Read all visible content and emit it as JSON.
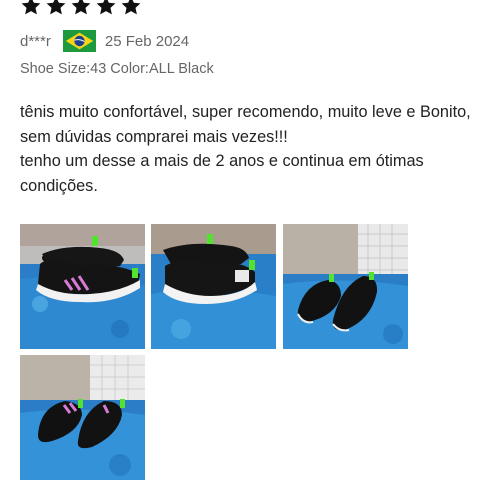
{
  "rating": {
    "value": 5,
    "max": 5,
    "icon": "star-icon",
    "color": "#111111"
  },
  "review": {
    "reviewer": "d***r",
    "country_flag_icon": "brazil-flag-icon",
    "date": "25 Feb 2024",
    "sku": "Shoe Size:43 Color:ALL Black",
    "text_lines": [
      "tênis muito confortável, super recomendo, muito leve e Bonito, sem dúvidas comprarei mais vezes!!!",
      "tenho um desse a mais de 2 anos e continua em ótimas condições."
    ]
  },
  "photos": [
    {
      "name": "review-photo-1",
      "icon": "shoe-photo"
    },
    {
      "name": "review-photo-2",
      "icon": "shoe-photo"
    },
    {
      "name": "review-photo-3",
      "icon": "shoe-photo"
    },
    {
      "name": "review-photo-4",
      "icon": "shoe-photo"
    }
  ]
}
